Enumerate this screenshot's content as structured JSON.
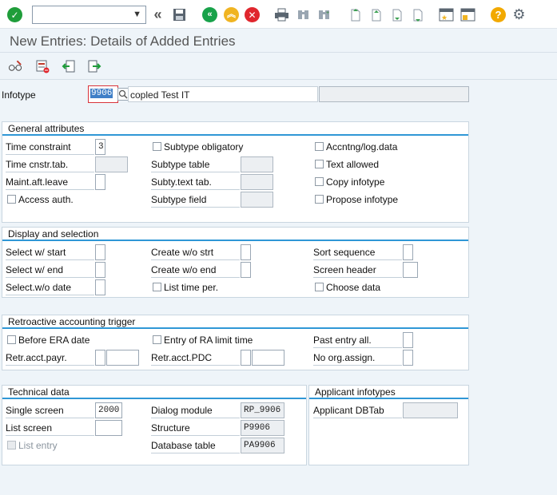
{
  "toolbar": {
    "command_value": "",
    "icons": [
      "enter-icon",
      "back-icon",
      "save-icon",
      "exit-icon",
      "cancel-icon",
      "print-icon",
      "find-icon",
      "find-next-icon",
      "first-page-icon",
      "previous-page-icon",
      "next-page-icon",
      "last-page-icon",
      "new-session-icon",
      "shortcut-icon",
      "help-icon",
      "settings-icon"
    ]
  },
  "title": "New Entries: Details of Added Entries",
  "infotype": {
    "label": "Infotype",
    "value": "9906",
    "description": "copled Test IT",
    "extra": ""
  },
  "general": {
    "heading": "General attributes",
    "time_constraint": {
      "label": "Time constraint",
      "value": "3"
    },
    "time_cnstr_tab": {
      "label": "Time cnstr.tab.",
      "value": ""
    },
    "maint_aft_leave": {
      "label": "Maint.aft.leave",
      "value": ""
    },
    "access_auth": {
      "label": "Access auth.",
      "checked": false
    },
    "subtype_obligatory": {
      "label": "Subtype obligatory",
      "checked": false
    },
    "subtype_table": {
      "label": "Subtype table",
      "value": ""
    },
    "subty_text_tab": {
      "label": "Subty.text tab.",
      "value": ""
    },
    "subtype_field": {
      "label": "Subtype field",
      "value": ""
    },
    "accntng_log_data": {
      "label": "Accntng/log.data",
      "checked": false
    },
    "text_allowed": {
      "label": "Text allowed",
      "checked": false
    },
    "copy_infotype": {
      "label": "Copy infotype",
      "checked": false
    },
    "propose_infotype": {
      "label": "Propose infotype",
      "checked": false
    }
  },
  "display": {
    "heading": "Display and selection",
    "select_w_start": {
      "label": "Select w/ start",
      "value": ""
    },
    "select_w_end": {
      "label": "Select w/ end",
      "value": ""
    },
    "select_wo_date": {
      "label": "Select.w/o date",
      "value": ""
    },
    "create_wo_strt": {
      "label": "Create w/o strt",
      "value": ""
    },
    "create_wo_end": {
      "label": "Create w/o end",
      "value": ""
    },
    "list_time_per": {
      "label": "List time per.",
      "checked": false
    },
    "sort_sequence": {
      "label": "Sort sequence",
      "value": ""
    },
    "screen_header": {
      "label": "Screen header",
      "value": ""
    },
    "choose_data": {
      "label": "Choose data",
      "checked": false
    }
  },
  "retro": {
    "heading": "Retroactive accounting trigger",
    "before_era_date": {
      "label": "Before ERA date",
      "checked": false
    },
    "retr_acct_payr": {
      "label": "Retr.acct.payr.",
      "value1": "",
      "value2": ""
    },
    "entry_of_ra_limit_time": {
      "label": "Entry of RA limit time",
      "checked": false
    },
    "retr_acct_pdc": {
      "label": "Retr.acct.PDC",
      "value1": "",
      "value2": ""
    },
    "past_entry_all": {
      "label": "Past entry all.",
      "value": ""
    },
    "no_org_assign": {
      "label": "No org.assign.",
      "value": ""
    }
  },
  "technical": {
    "heading": "Technical data",
    "single_screen": {
      "label": "Single screen",
      "value": "2000"
    },
    "list_screen": {
      "label": "List screen",
      "value": ""
    },
    "list_entry": {
      "label": "List entry",
      "checked": false
    },
    "dialog_module": {
      "label": "Dialog module",
      "value": "RP_9906"
    },
    "structure": {
      "label": "Structure",
      "value": "P9906"
    },
    "database_table": {
      "label": "Database table",
      "value": "PA9906"
    }
  },
  "applicant": {
    "heading": "Applicant infotypes",
    "applicant_dbtab": {
      "label": "Applicant DBTab",
      "value": ""
    }
  },
  "colors": {
    "accent_blue": "#2f97d6",
    "enter_green": "#1f9d3a",
    "back_green": "#18a24a",
    "exit_yellow": "#f0b422",
    "cancel_red": "#e0262d",
    "help_yellow": "#f2a900"
  }
}
